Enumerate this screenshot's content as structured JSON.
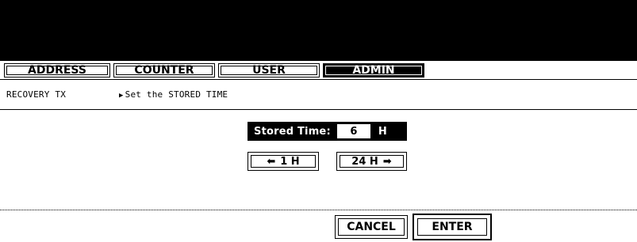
{
  "tabs": [
    {
      "label": "ADDRESS"
    },
    {
      "label": "COUNTER"
    },
    {
      "label": "USER"
    },
    {
      "label": "ADMIN"
    }
  ],
  "context": "RECOVERY TX",
  "instruction": "Set the STORED TIME",
  "stored": {
    "label": "Stored Time:",
    "value": "6",
    "unit": "H"
  },
  "increment": {
    "left_label": "1 H",
    "right_label": "24 H"
  },
  "actions": {
    "cancel": "CANCEL",
    "enter": "ENTER"
  }
}
